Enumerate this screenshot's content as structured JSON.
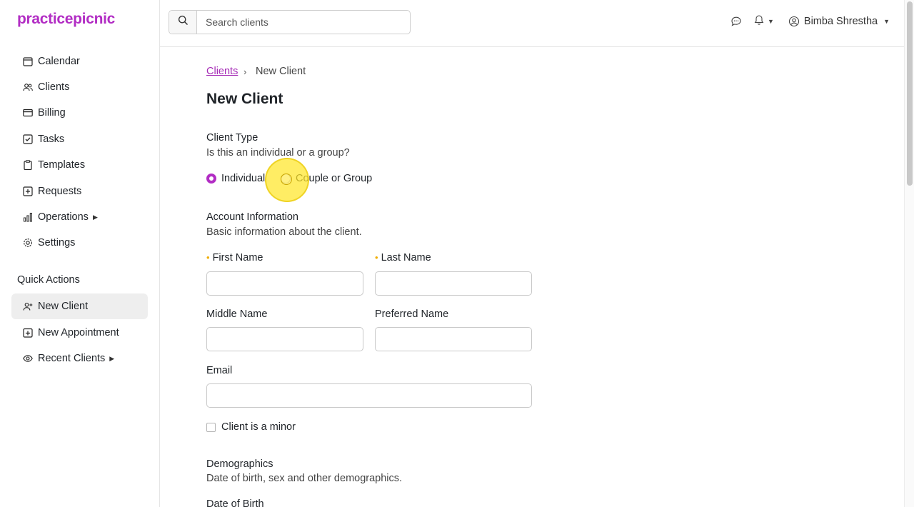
{
  "app": {
    "logo": "practicepicnic"
  },
  "sidebar": {
    "items": [
      {
        "label": "Calendar",
        "icon": "calendar-icon"
      },
      {
        "label": "Clients",
        "icon": "users-icon"
      },
      {
        "label": "Billing",
        "icon": "credit-card-icon"
      },
      {
        "label": "Tasks",
        "icon": "checkbox-icon"
      },
      {
        "label": "Templates",
        "icon": "clipboard-icon"
      },
      {
        "label": "Requests",
        "icon": "plus-square-icon"
      },
      {
        "label": "Operations",
        "icon": "bar-chart-icon",
        "has_submenu": true
      },
      {
        "label": "Settings",
        "icon": "gear-icon"
      }
    ],
    "quick_actions_title": "Quick Actions",
    "quick_actions": [
      {
        "label": "New Client",
        "icon": "user-plus-icon",
        "active": true
      },
      {
        "label": "New Appointment",
        "icon": "calendar-plus-icon"
      },
      {
        "label": "Recent Clients",
        "icon": "eye-icon",
        "has_submenu": true
      }
    ]
  },
  "topbar": {
    "search_placeholder": "Search clients",
    "user_name": "Bimba Shrestha"
  },
  "breadcrumb": {
    "parent": "Clients",
    "separator": "›",
    "current": "New Client"
  },
  "page_title": "New Client",
  "client_type": {
    "title": "Client Type",
    "subtitle": "Is this an individual or a group?",
    "options": [
      {
        "label": "Individual",
        "selected": true
      },
      {
        "label": "Couple or Group",
        "selected": false
      }
    ]
  },
  "account_info": {
    "title": "Account Information",
    "subtitle": "Basic information about the client.",
    "fields": {
      "first_name": {
        "label": "First Name",
        "required": "•",
        "value": ""
      },
      "last_name": {
        "label": "Last Name",
        "required": "•",
        "value": ""
      },
      "middle_name": {
        "label": "Middle Name",
        "value": ""
      },
      "preferred_name": {
        "label": "Preferred Name",
        "value": ""
      },
      "email": {
        "label": "Email",
        "value": ""
      }
    },
    "minor_checkbox": {
      "label": "Client is a minor",
      "checked": false
    }
  },
  "demographics": {
    "title": "Demographics",
    "subtitle": "Date of birth, sex and other demographics.",
    "dob_label": "Date of Birth"
  },
  "colors": {
    "brand": "#b22dc4",
    "required": "#f0ad00"
  }
}
